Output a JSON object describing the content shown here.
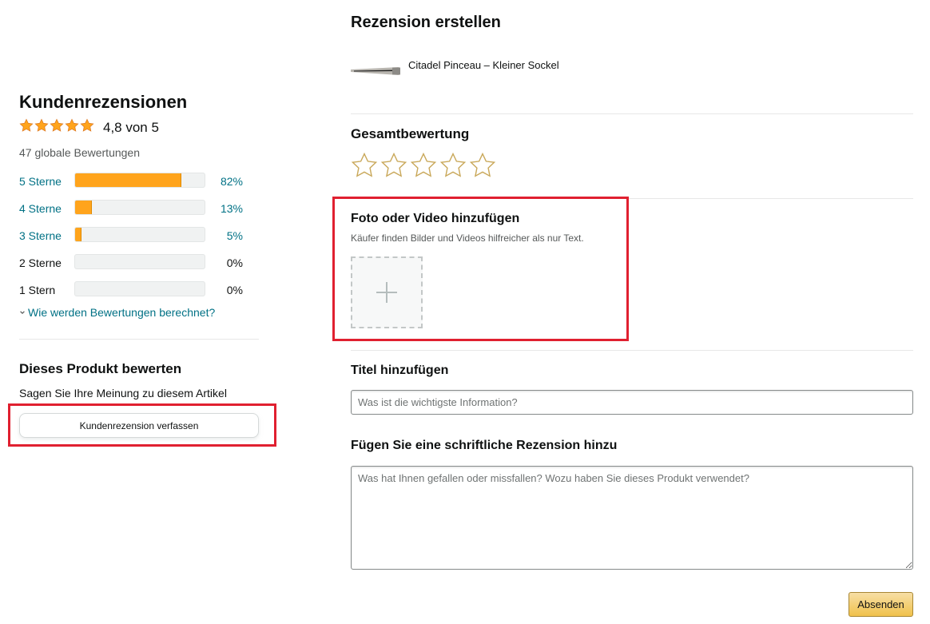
{
  "ratings_summary": {
    "title": "Kundenrezensionen",
    "average_text": "4,8 von 5",
    "average_value": 4.8,
    "global_count": "47 globale Bewertungen",
    "histogram": [
      {
        "label": "5 Sterne",
        "percent_text": "82%",
        "percent": 82
      },
      {
        "label": "4 Sterne",
        "percent_text": "13%",
        "percent": 13
      },
      {
        "label": "3 Sterne",
        "percent_text": "5%",
        "percent": 5
      },
      {
        "label": "2 Sterne",
        "percent_text": "0%",
        "percent": 0
      },
      {
        "label": "1 Stern",
        "percent_text": "0%",
        "percent": 0
      }
    ],
    "how_link": "Wie werden Bewertungen berechnet?"
  },
  "rate_product": {
    "title": "Dieses Produkt bewerten",
    "subtitle": "Sagen Sie Ihre Meinung zu diesem Artikel",
    "button_label": "Kundenrezension verfassen"
  },
  "review_form": {
    "title": "Rezension erstellen",
    "product_name": "Citadel Pinceau – Kleiner Sockel",
    "overall_title": "Gesamtbewertung",
    "star_count": 5,
    "photo_title": "Foto oder Video hinzufügen",
    "photo_subtitle": "Käufer finden Bilder und Videos hilfreicher als nur Text.",
    "headline_label": "Titel hinzufügen",
    "headline_placeholder": "Was ist die wichtigste Information?",
    "headline_value": "",
    "review_label": "Fügen Sie eine schriftliche Rezension hinzu",
    "review_placeholder": "Was hat Ihnen gefallen oder missfallen? Wozu haben Sie dieses Produkt verwendet?",
    "review_value": "",
    "submit_label": "Absenden"
  },
  "colors": {
    "link": "#007185",
    "star_fill": "#ffa41c",
    "highlight_box": "#e02030",
    "submit_button": "#f0c14b"
  },
  "icons": {
    "star": "star-icon",
    "empty_star": "empty-star-icon",
    "chevron": "chevron-down-icon",
    "add": "plus-icon"
  }
}
